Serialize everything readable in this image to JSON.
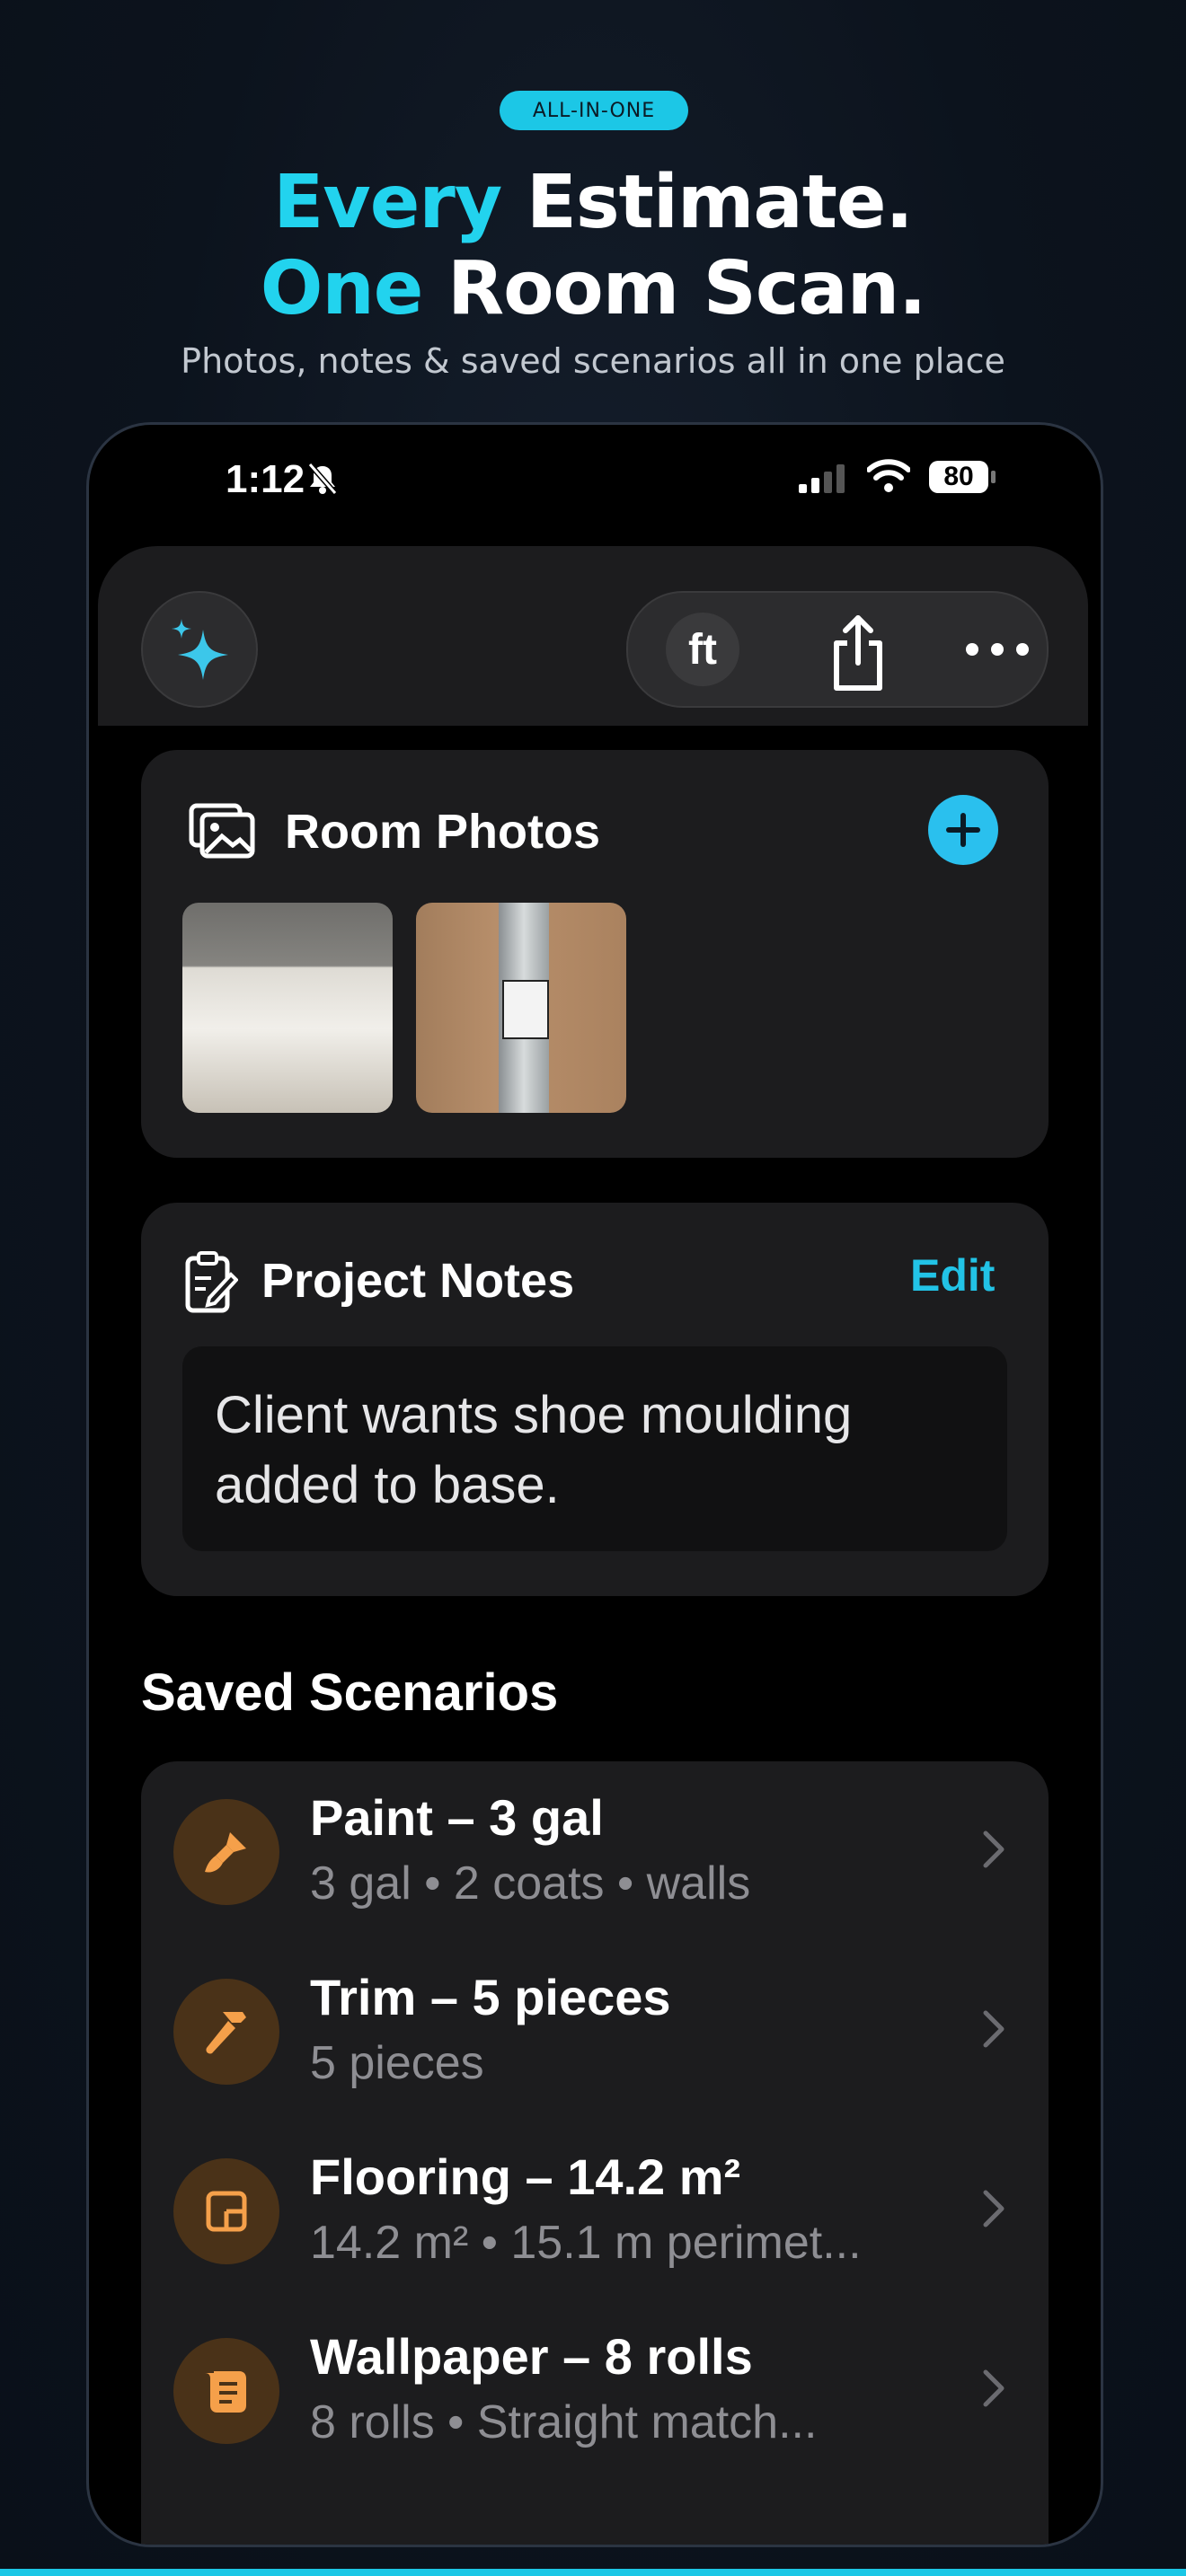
{
  "promo": {
    "badge": "ALL-IN-ONE",
    "line1_accent": "Every",
    "line1_rest": "Estimate.",
    "line2_accent": "One",
    "line2_rest": "Room Scan.",
    "subtitle": "Photos, notes & saved scenarios all in one place"
  },
  "status_bar": {
    "time": "1:12",
    "battery": "80"
  },
  "toolbar": {
    "unit_label": "ft",
    "ai_icon": "sparkles-icon",
    "share_icon": "share-icon",
    "more_icon": "ellipsis-icon"
  },
  "room_photos": {
    "title": "Room Photos",
    "icon": "photos-icon",
    "add_icon": "plus-icon"
  },
  "project_notes": {
    "title": "Project Notes",
    "edit_label": "Edit",
    "note": "Client wants shoe moulding added to base."
  },
  "saved_scenarios": {
    "title": "Saved Scenarios",
    "items": [
      {
        "title": "Paint – 3 gal",
        "subtitle": "3 gal • 2 coats • walls",
        "icon": "paintbrush-icon"
      },
      {
        "title": "Trim – 5 pieces",
        "subtitle": "5 pieces",
        "icon": "hammer-icon"
      },
      {
        "title": "Flooring – 14.2 m²",
        "subtitle": "14.2 m² • 15.1 m perimet...",
        "icon": "floor-plan-icon"
      },
      {
        "title": "Wallpaper – 8 rolls",
        "subtitle": "8 rolls • Straight match...",
        "icon": "scroll-icon"
      }
    ]
  },
  "colors": {
    "accent": "#22d3ee",
    "card": "#1c1c1e",
    "scenario_icon_bg": "#4a3218",
    "scenario_icon": "#f5a04a"
  }
}
